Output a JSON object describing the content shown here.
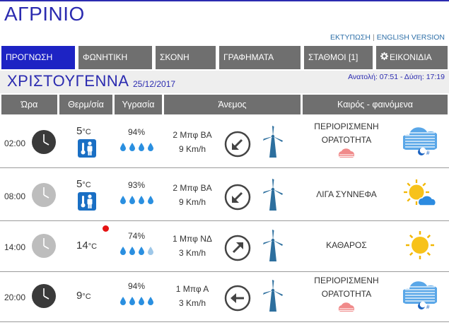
{
  "header": {
    "city": "ΑΓΡΙΝΙΟ",
    "print_link": "ΕΚΤΥΠΩΣΗ",
    "separator": "|",
    "english_link": "ENGLISH VERSION"
  },
  "nav": {
    "tabs": [
      {
        "label": "ΠΡΟΓΝΩΣΗ",
        "active": true
      },
      {
        "label": "ΦΩΝΗΤΙΚΗ",
        "active": false
      },
      {
        "label": "ΣΚΟΝΗ",
        "active": false
      },
      {
        "label": "ΓΡΑΦΗΜΑΤΑ",
        "active": false
      },
      {
        "label": "ΣΤΑΘΜΟΙ [1]",
        "active": false
      },
      {
        "label": "ΕΙΚΟΝΙΔΙΑ",
        "active": false,
        "icon": "gear-icon"
      }
    ]
  },
  "day": {
    "name": "ΧΡΙΣΤΟΥΓΕΝΝΑ",
    "date": "25/12/2017",
    "sun": "Ανατολή: 07:51 - Δύση: 17:19"
  },
  "columns": {
    "hour": "Ώρα",
    "temp": "Θερμ/σία",
    "humidity": "Υγρασία",
    "wind": "Άνεμος",
    "weather": "Καιρός - φαινόμενα"
  },
  "rows": [
    {
      "time": "02:00",
      "temp": "5",
      "unit": "°C",
      "humidity": "94%",
      "drops_filled": 4,
      "wind_bf": "2 Μπφ ΒΑ",
      "wind_kmh": "9 Km/h",
      "wind_dir": "arrow-down-left-icon",
      "cond1": "ΠΕΡΙΟΡΙΣΜΕΝΗ",
      "cond2": "ΟΡΑΤΟΤΗΤΑ",
      "icon": "fog-night-icon",
      "night": true,
      "cold_icon": true
    },
    {
      "time": "08:00",
      "temp": "5",
      "unit": "°C",
      "humidity": "93%",
      "drops_filled": 4,
      "wind_bf": "2 Μπφ ΒΑ",
      "wind_kmh": "9 Km/h",
      "wind_dir": "arrow-down-left-icon",
      "cond1": "ΛΙΓΑ ΣΥΝΝΕΦΑ",
      "cond2": "",
      "icon": "sun-cloud-icon",
      "night": false,
      "cold_icon": true
    },
    {
      "time": "14:00",
      "temp": "14",
      "unit": "°C",
      "humidity": "74%",
      "drops_filled": 3,
      "wind_bf": "1 Μπφ ΝΔ",
      "wind_kmh": "3 Km/h",
      "wind_dir": "arrow-up-right-icon",
      "cond1": "ΚΑΘΑΡΟΣ",
      "cond2": "",
      "icon": "sun-icon",
      "night": false,
      "cold_icon": false
    },
    {
      "time": "20:00",
      "temp": "9",
      "unit": "°C",
      "humidity": "94%",
      "drops_filled": 4,
      "wind_bf": "1 Μπφ Α",
      "wind_kmh": "3 Km/h",
      "wind_dir": "arrow-left-icon",
      "cond1": "ΠΕΡΙΟΡΙΣΜΕΝΗ",
      "cond2": "ΟΡΑΤΟΤΗΤΑ",
      "icon": "fog-night-icon",
      "night": true,
      "cold_icon": false
    }
  ],
  "colors": {
    "brand": "#2b2bb0",
    "tab_active": "#1d23c4",
    "tab": "#6f6f6f",
    "drop": "#2a8fe0",
    "alert": "#e51313"
  }
}
